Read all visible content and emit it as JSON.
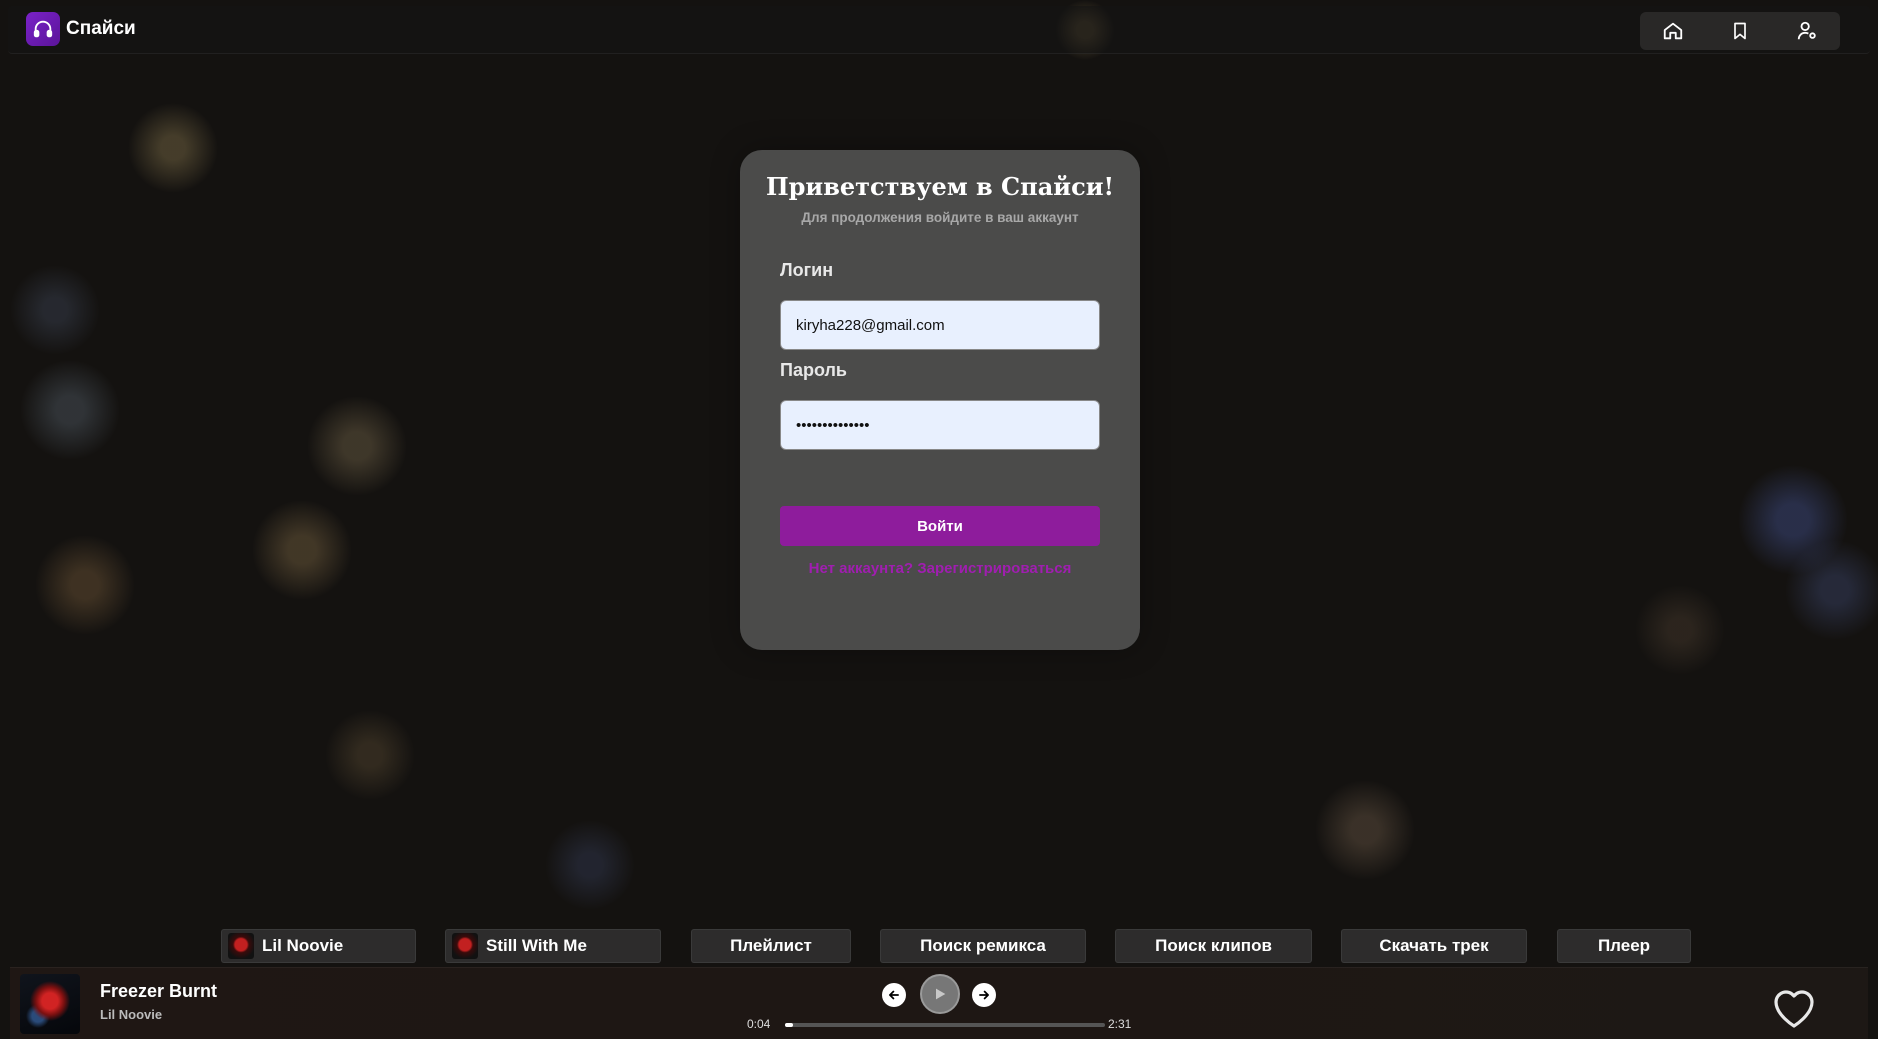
{
  "app": {
    "name": "Спайси",
    "accent": "#8e1c9c"
  },
  "nav": {
    "icons": [
      "home-icon",
      "bookmark-icon",
      "account-icon"
    ]
  },
  "login": {
    "title": "Приветствуем в Спайси!",
    "subtitle": "Для продолжения войдите в ваш аккаунт",
    "login_label": "Логин",
    "login_value": "kiryha228@gmail.com",
    "password_label": "Пароль",
    "password_value": "••••••••••••••",
    "submit_label": "Войти",
    "register_link": "Нет аккаунта? Зарегистрироваться"
  },
  "tabs": {
    "artist": "Lil Noovie",
    "album": "Still With Me",
    "playlist": "Плейлист",
    "remix": "Поиск ремикса",
    "clips": "Поиск клипов",
    "download": "Скачать трек",
    "player": "Плеер"
  },
  "player": {
    "track_title": "Freezer Burnt",
    "artist": "Lil Noovie",
    "current_time": "0:04",
    "total_time": "2:31",
    "progress": 0.026
  }
}
